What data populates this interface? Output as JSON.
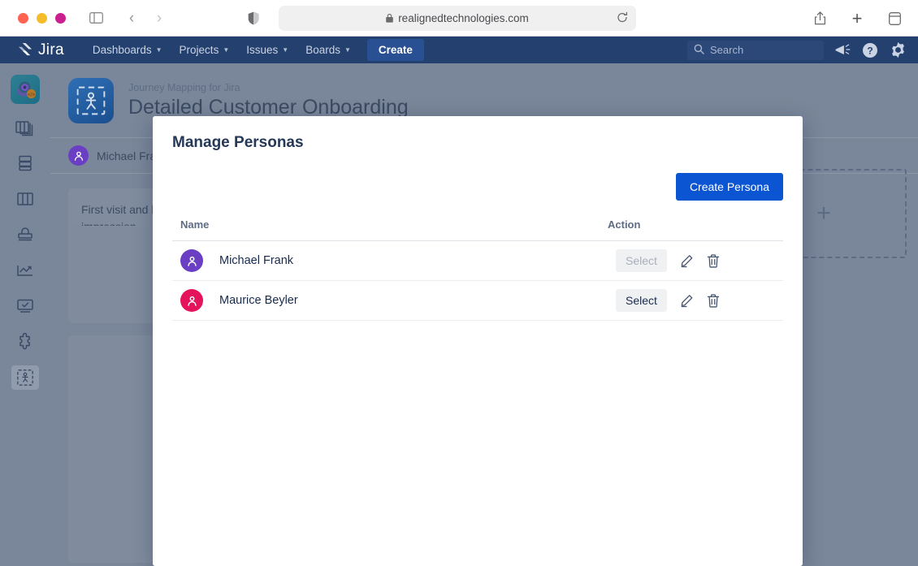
{
  "browser": {
    "url": "realignedtechnologies.com",
    "lock_icon": "lock-icon",
    "shield_icon": "shield-icon",
    "reload_icon": "reload-icon",
    "sidebar_icon": "sidebar-toggle-icon",
    "back_glyph": "‹",
    "forward_glyph": "›",
    "share_icon": "share-icon",
    "new_tab_glyph": "+",
    "tabs_icon": "tabs-overview-icon",
    "traffic_lights": [
      "#ff6250",
      "#f5bc2b",
      "#cc1f8f"
    ]
  },
  "jira_nav": {
    "logo_text": "Jira",
    "items": [
      {
        "label": "Dashboards",
        "has_caret": true
      },
      {
        "label": "Projects",
        "has_caret": true
      },
      {
        "label": "Issues",
        "has_caret": true
      },
      {
        "label": "Boards",
        "has_caret": true
      }
    ],
    "create_label": "Create",
    "search_placeholder": "Search",
    "search_icon": "search-icon",
    "announcements_icon": "megaphone-icon",
    "help_icon": "help-circle-icon",
    "settings_icon": "gear-icon",
    "bg_color": "#24406f",
    "create_bg": "#2a5094"
  },
  "rail": {
    "app_icon": "journey-mapping-app-icon",
    "items": [
      {
        "name": "rail-item-backlog",
        "icon": "columns-stack-icon"
      },
      {
        "name": "rail-item-database",
        "icon": "database-icon"
      },
      {
        "name": "rail-item-board",
        "icon": "board-columns-icon"
      },
      {
        "name": "rail-item-deploy",
        "icon": "deployment-icon"
      },
      {
        "name": "rail-item-reports",
        "icon": "chart-line-icon"
      },
      {
        "name": "rail-item-tests",
        "icon": "monitor-check-icon"
      },
      {
        "name": "rail-item-addons",
        "icon": "puzzle-piece-icon"
      },
      {
        "name": "rail-item-journey-mapping",
        "icon": "journey-person-icon",
        "selected": true
      }
    ]
  },
  "project": {
    "app_name": "Journey Mapping for Jira",
    "title": "Detailed Customer Onboarding",
    "icon": "journey-mapping-project-icon",
    "active_persona": "Michael Fra",
    "active_persona_avatar_color": "#6b3fc4",
    "stage_card": "First visit and b\nimpression",
    "dropzone_glyph": "+"
  },
  "modal": {
    "title": "Manage Personas",
    "create_button": "Create Persona",
    "accent_color": "#0b55d3",
    "columns": [
      "Name",
      "Action"
    ],
    "rows": [
      {
        "name": "Michael Frank",
        "avatar_color": "#6b3fc4",
        "select_label": "Select",
        "select_disabled": true,
        "edit_icon": "pencil-icon",
        "delete_icon": "trash-icon"
      },
      {
        "name": "Maurice Beyler",
        "avatar_color": "#e5125c",
        "select_label": "Select",
        "select_disabled": false,
        "edit_icon": "pencil-icon",
        "delete_icon": "trash-icon"
      }
    ]
  }
}
